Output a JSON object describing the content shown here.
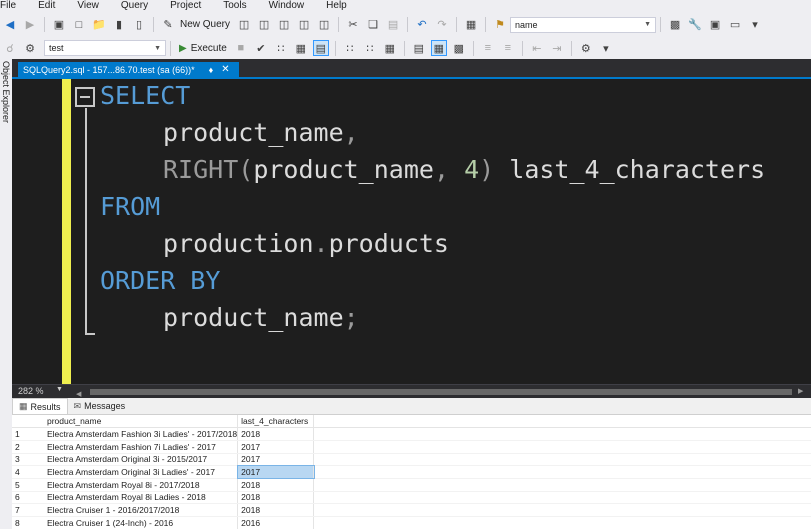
{
  "menu": [
    "File",
    "Edit",
    "View",
    "Query",
    "Project",
    "Tools",
    "Window",
    "Help"
  ],
  "toolbar1": {
    "new_query_label": "New Query",
    "search_combo_value": "name"
  },
  "toolbar2": {
    "database_value": "test",
    "execute_label": "Execute"
  },
  "side_panel": {
    "object_explorer_label": "Object Explorer"
  },
  "document_tab": {
    "title": "SQLQuery2.sql - 157...86.70.test (sa (66))*"
  },
  "editor": {
    "zoom": "282 %",
    "lines": [
      {
        "kw": "SELECT"
      },
      {
        "col": "product_name",
        "punc": ","
      },
      {
        "fn": "RIGHT",
        "open": "(",
        "arg": "product_name",
        "comma": ",",
        "num": "4",
        "close": ")",
        "alias": "last_4_characters"
      },
      {
        "kw": "FROM"
      },
      {
        "schema": "production",
        "dot": ".",
        "table": "products"
      },
      {
        "kw": "ORDER BY"
      },
      {
        "col": "product_name",
        "punc": ";"
      }
    ]
  },
  "results_panel": {
    "tabs": [
      "Results",
      "Messages"
    ],
    "columns": [
      "product_name",
      "last_4_characters"
    ],
    "rows": [
      {
        "n": "1",
        "product_name": "Electra Amsterdam Fashion 3i Ladies' - 2017/2018",
        "last_4_characters": "2018"
      },
      {
        "n": "2",
        "product_name": "Electra Amsterdam Fashion 7i Ladies' - 2017",
        "last_4_characters": "2017"
      },
      {
        "n": "3",
        "product_name": "Electra Amsterdam Original 3i - 2015/2017",
        "last_4_characters": "2017"
      },
      {
        "n": "4",
        "product_name": "Electra Amsterdam Original 3i Ladies' - 2017",
        "last_4_characters": "2017"
      },
      {
        "n": "5",
        "product_name": "Electra Amsterdam Royal 8i - 2017/2018",
        "last_4_characters": "2018"
      },
      {
        "n": "6",
        "product_name": "Electra Amsterdam Royal 8i Ladies - 2018",
        "last_4_characters": "2018"
      },
      {
        "n": "7",
        "product_name": "Electra Cruiser 1 - 2016/2017/2018",
        "last_4_characters": "2018"
      },
      {
        "n": "8",
        "product_name": "Electra Cruiser 1 (24-Inch) - 2016",
        "last_4_characters": "2016"
      }
    ],
    "selected_row": 4
  },
  "colors": {
    "accent": "#007acc",
    "keyword": "#569cd6",
    "editor_bg": "#1e1e1e",
    "margin_marker": "#efef4f"
  }
}
